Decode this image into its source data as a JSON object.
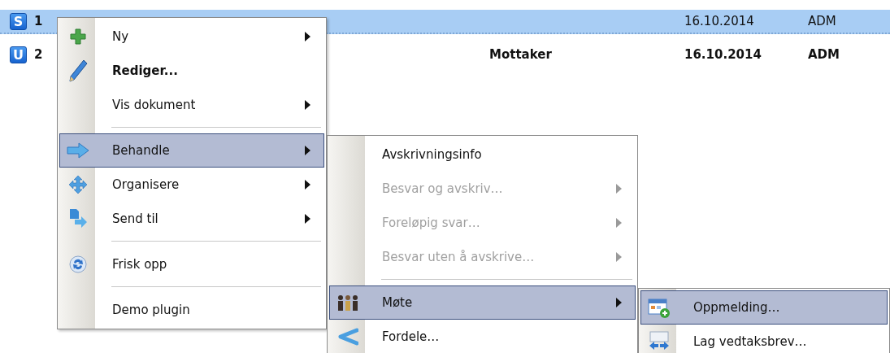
{
  "rows": [
    {
      "badge": "S",
      "number": "1",
      "date": "16.10.2014",
      "user": "ADM",
      "selected": true,
      "unread": false
    },
    {
      "badge": "U",
      "number": "2",
      "recipient": "Mottaker",
      "date": "16.10.2014",
      "user": "ADM",
      "selected": false,
      "unread": true
    }
  ],
  "menus": [
    {
      "items": [
        {
          "kind": "item",
          "label": "Ny",
          "submenu": true,
          "selected": false,
          "disabled": false,
          "default": false
        },
        {
          "kind": "item",
          "label": "Rediger...",
          "submenu": false,
          "selected": false,
          "disabled": false,
          "default": true
        },
        {
          "kind": "item",
          "label": "Vis dokument",
          "submenu": true,
          "selected": false,
          "disabled": false,
          "default": false
        },
        {
          "kind": "separator"
        },
        {
          "kind": "item",
          "label": "Behandle",
          "submenu": true,
          "selected": true,
          "disabled": false,
          "default": false
        },
        {
          "kind": "item",
          "label": "Organisere",
          "submenu": true,
          "selected": false,
          "disabled": false,
          "default": false
        },
        {
          "kind": "item",
          "label": "Send til",
          "submenu": true,
          "selected": false,
          "disabled": false,
          "default": false
        },
        {
          "kind": "separator"
        },
        {
          "kind": "item",
          "label": "Frisk opp",
          "submenu": false,
          "selected": false,
          "disabled": false,
          "default": false
        },
        {
          "kind": "separator"
        },
        {
          "kind": "item",
          "label": "Demo plugin",
          "submenu": false,
          "selected": false,
          "disabled": false,
          "default": false
        }
      ]
    },
    {
      "items": [
        {
          "kind": "item",
          "label": "Avskrivningsinfo",
          "submenu": false,
          "selected": false,
          "disabled": false,
          "default": false
        },
        {
          "kind": "item",
          "label": "Besvar og avskriv…",
          "submenu": true,
          "selected": false,
          "disabled": true,
          "default": false
        },
        {
          "kind": "item",
          "label": "Foreløpig svar…",
          "submenu": true,
          "selected": false,
          "disabled": true,
          "default": false
        },
        {
          "kind": "item",
          "label": "Besvar uten å avskrive…",
          "submenu": true,
          "selected": false,
          "disabled": true,
          "default": false
        },
        {
          "kind": "separator"
        },
        {
          "kind": "item",
          "label": "Møte",
          "submenu": true,
          "selected": true,
          "disabled": false,
          "default": false
        },
        {
          "kind": "item",
          "label": "Fordele…",
          "submenu": false,
          "selected": false,
          "disabled": false,
          "default": false
        }
      ]
    },
    {
      "items": [
        {
          "kind": "item",
          "label": "Oppmelding…",
          "submenu": false,
          "selected": true,
          "disabled": false,
          "default": false
        },
        {
          "kind": "item",
          "label": "Lag vedtaksbrev…",
          "submenu": false,
          "selected": false,
          "disabled": false,
          "default": false
        }
      ]
    }
  ]
}
